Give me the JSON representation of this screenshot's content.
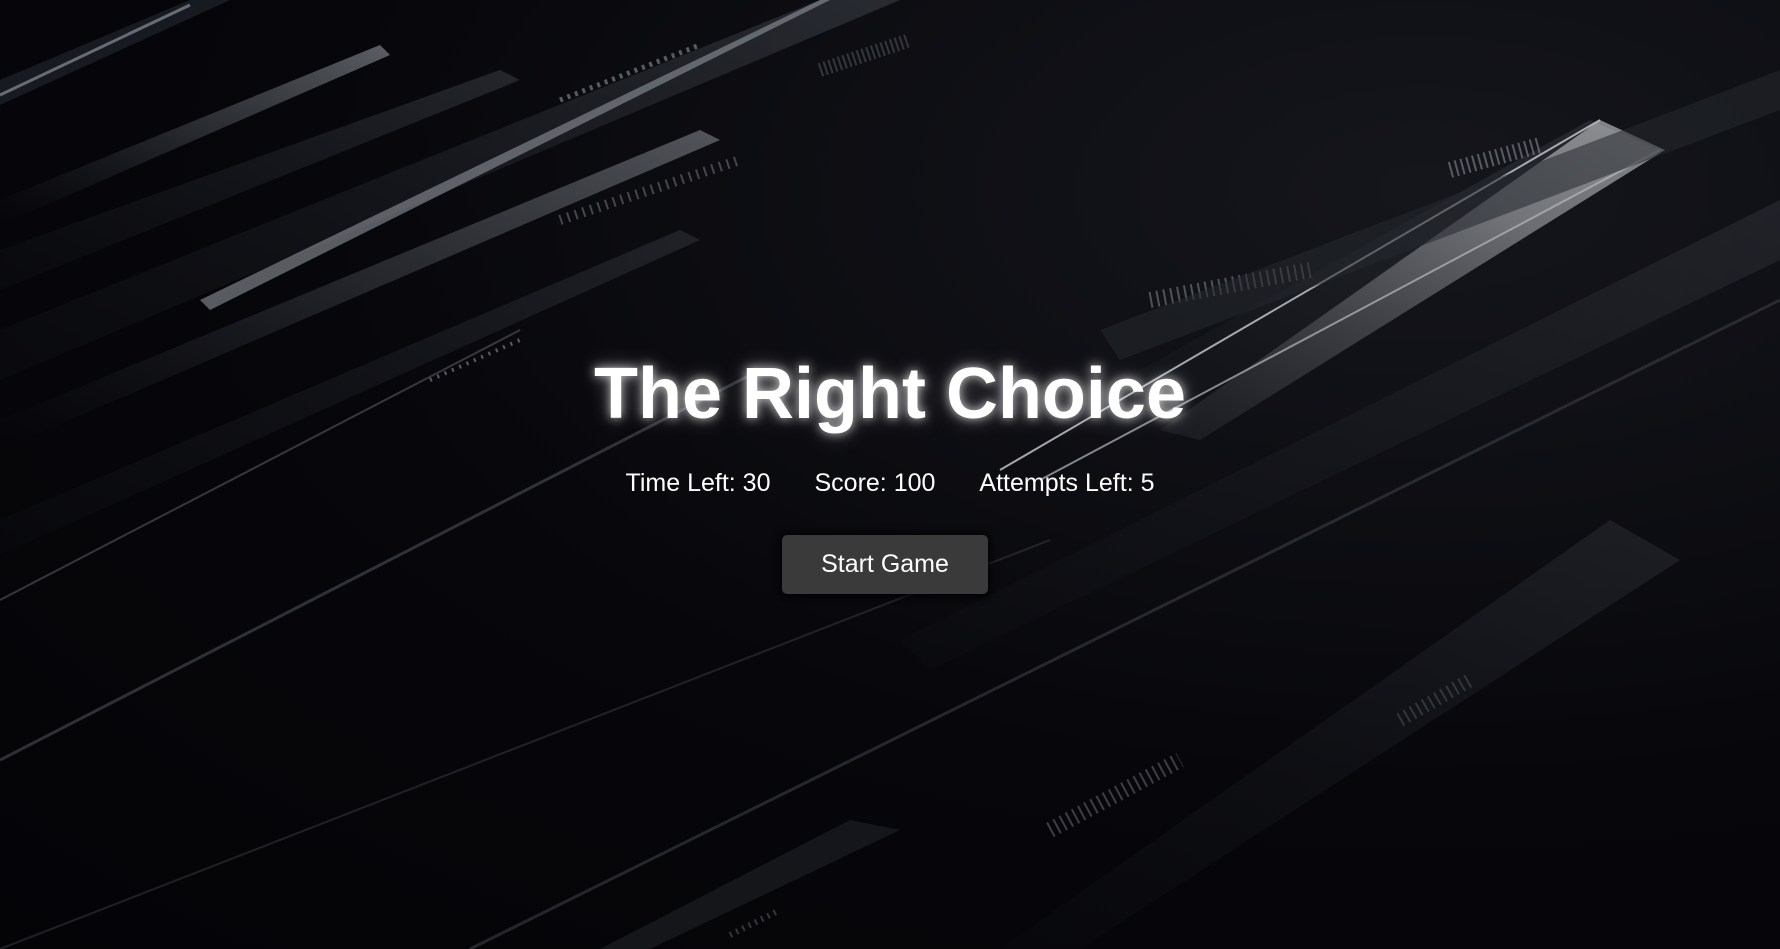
{
  "game": {
    "title": "The Right Choice",
    "stats": {
      "time_label": "Time Left: ",
      "time_value": "30",
      "score_label": "Score: ",
      "score_value": "100",
      "attempts_label": "Attempts Left: ",
      "attempts_value": "5"
    },
    "start_button_label": "Start Game"
  },
  "colors": {
    "background": "#07070b",
    "text": "#ffffff",
    "button_bg": "#3a3a3a"
  }
}
